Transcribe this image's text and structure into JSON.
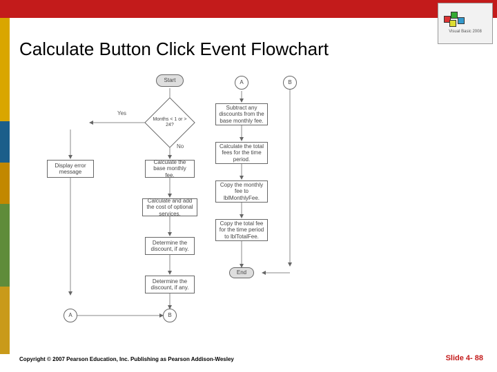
{
  "header": {
    "title": "Calculate Button Click Event Flowchart"
  },
  "corner": {
    "caption": "Visual Basic 2008"
  },
  "flow": {
    "start": "Start",
    "decision": "Months < 1 or > 24?",
    "yes": "Yes",
    "no": "No",
    "error": "Display error message",
    "base": "Calculate the base monthly fee.",
    "optional": "Calculate and add the cost of optional services.",
    "discount": "Determine the discount, if any.",
    "connA": "A",
    "connB": "B",
    "connA2": "A",
    "connB2": "B",
    "subtract": "Subtract any discounts from the base monthly fee.",
    "total": "Calculate the total fees for the time period.",
    "copymonthly": "Copy the monthly fee to lblMonthlyFee.",
    "copytotal": "Copy the total fee for the time period to lblTotalFee.",
    "end": "End"
  },
  "footer": {
    "copyright": "Copyright © 2007 Pearson Education, Inc. Publishing as Pearson Addison-Wesley",
    "slide": "Slide 4- 88"
  }
}
